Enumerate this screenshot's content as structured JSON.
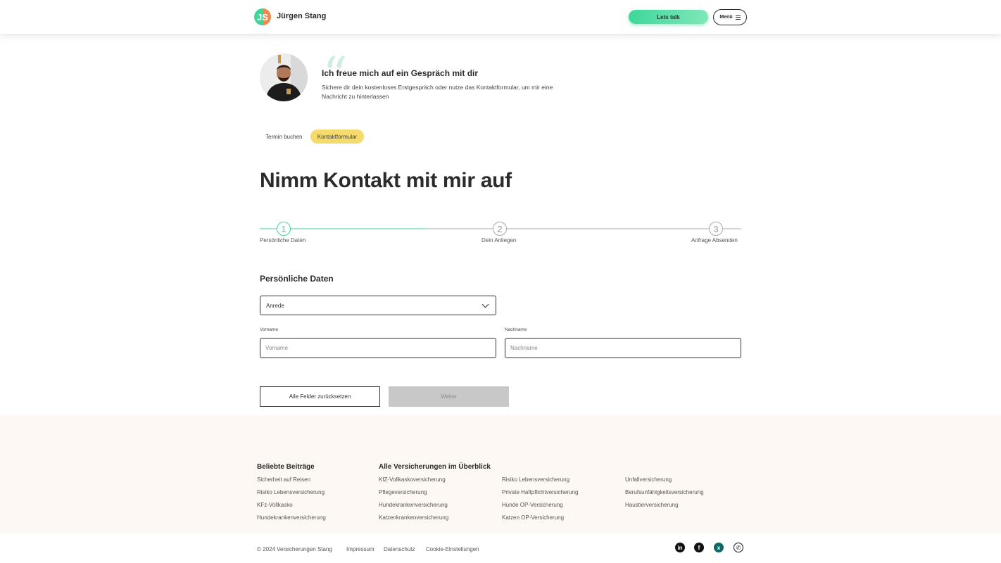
{
  "header": {
    "brand": "Jürgen Stang",
    "cta_label": "Lets talk",
    "menu_label": "Menü"
  },
  "intro": {
    "title": "Ich freue mich auf ein Gespräch mit dir",
    "text": "Sichere dir dein kostenloses Erstgespräch oder nutze das Kontaktformular, um mir eine Nachricht zu hinterlassen"
  },
  "tabs": [
    {
      "label": "Termin buchen"
    },
    {
      "label": "Kontaktformular",
      "active": true
    }
  ],
  "page_title": "Nimm Kontakt mit mir auf",
  "steps": [
    {
      "number": "1",
      "label": "Persönliche Daten",
      "active": true
    },
    {
      "number": "2",
      "label": "Dein Anliegen"
    },
    {
      "number": "3",
      "label": "Anfrage Absenden"
    }
  ],
  "form": {
    "section_title": "Persönliche Daten",
    "salutation_value": "Anrede",
    "firstname_label": "Vorname",
    "firstname_placeholder": "Vorname",
    "lastname_label": "Nachname",
    "lastname_placeholder": "Nachname",
    "reset_label": "Alle Felder zurücksetzen",
    "next_label": "Weiter"
  },
  "footer": {
    "col1_title": "Beliebte Beiträge",
    "col1_links": [
      "Sicherheit auf Reisen",
      "Risiko Lebensversicherung",
      "KFz-Vollkasko",
      "Hundekrankenversicherung"
    ],
    "col2_title": "Alle Versicherungen im Überblick",
    "col2_links": [
      "KfZ-Vollkaskoversicherung",
      "Pflegeversicherung",
      "Hundekrankenversicherung",
      "Katzenkrankenversicherung"
    ],
    "col3_links": [
      "Risiko Lebensversicherung",
      "Private Haftpflichtversicherung",
      "Hunde OP-Versicherung",
      "Katzen OP-Versicherung"
    ],
    "col4_links": [
      "Unfallversicherung",
      "Berufsunfähigkeitsversicherung",
      "Haustierversicherung"
    ],
    "copyright": "© 2024 Versicherungen Stang",
    "bottom_links": [
      "Impressum",
      "Datenschutz",
      "Cookie-Einstellungen"
    ],
    "social_icons": [
      "linkedin-icon",
      "facebook-icon",
      "xing-icon",
      "whatsapp-icon"
    ]
  },
  "colors": {
    "accent_green": "#3ed79a",
    "tab_active_yellow": "#f5db6e",
    "footer_bg": "#fdf8f4",
    "xing_teal": "#0b6b64"
  }
}
